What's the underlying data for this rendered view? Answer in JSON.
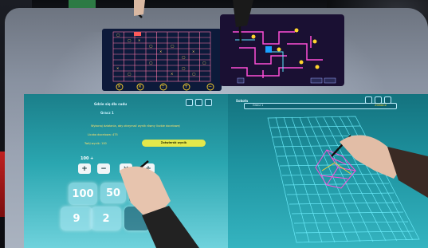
{
  "sudoku": {
    "operator_icons": [
      "×",
      "×",
      "÷",
      "+",
      "−"
    ]
  },
  "bottom_left": {
    "title": "Gdzie się dla cudu",
    "player": "Gracz 1",
    "instruction": "Wykonaj działania, aby otrzymać wynik równy liczbie docelowej",
    "target_label": "Liczba docelowa: 475",
    "result_label": "Twój wynik: 100",
    "confirm_button": "Zatwierdź wynik",
    "expression_value": "100 +",
    "operators": [
      "+",
      "−",
      "×",
      "÷"
    ],
    "number_tiles": [
      "100",
      "50",
      "",
      "9",
      "2",
      ""
    ]
  },
  "bottom_right": {
    "title": "Sokoła",
    "player": "Gracz 1",
    "status": "ZOBACZ"
  },
  "colors": {
    "neon_pink": "#ff4fd8",
    "neon_yellow": "#ffd52e",
    "neon_cyan": "#5fe8ff",
    "panel_teal": "#1e93a0"
  }
}
